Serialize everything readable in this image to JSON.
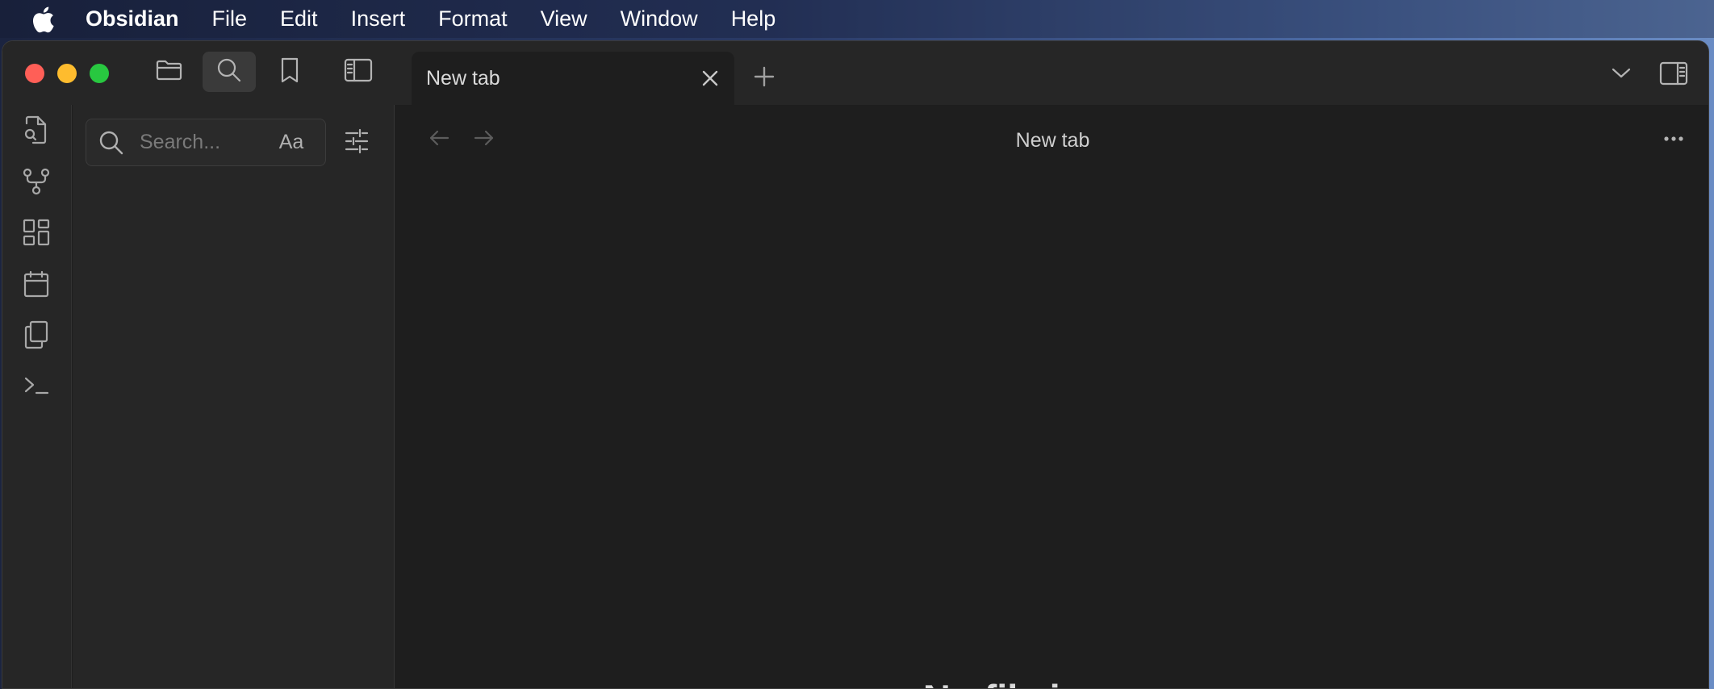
{
  "menubar": {
    "apple_icon": "apple-logo",
    "app_name": "Obsidian",
    "items": [
      "File",
      "Edit",
      "Insert",
      "Format",
      "View",
      "Window",
      "Help"
    ]
  },
  "window": {
    "traffic_lights": {
      "close": "#ff5f57",
      "minimize": "#febc2e",
      "zoom": "#28c840"
    },
    "toolbar_icons": [
      "folder-icon",
      "search-icon",
      "bookmark-icon",
      "sidebar-toggle-icon"
    ],
    "active_toolbar_icon": "search-icon",
    "tab": {
      "label": "New tab",
      "close_icon": "close-icon"
    },
    "new_tab_icon": "plus-icon",
    "right_icons": [
      "chevron-down-icon",
      "right-sidebar-toggle-icon"
    ]
  },
  "ribbon": {
    "icons": [
      "file-search-icon",
      "graph-icon",
      "canvas-icon",
      "calendar-icon",
      "copy-icon",
      "terminal-icon"
    ]
  },
  "sidebar": {
    "search": {
      "value": "",
      "placeholder": "Search...",
      "case_label": "Aa"
    },
    "filter_icon": "sliders-icon"
  },
  "main": {
    "title": "New tab",
    "empty_state": "No file is open",
    "more_icon": "more-horizontal-icon"
  },
  "colors": {
    "background": "#1e1e1e",
    "panel": "#262626",
    "text": "#dcddde"
  }
}
